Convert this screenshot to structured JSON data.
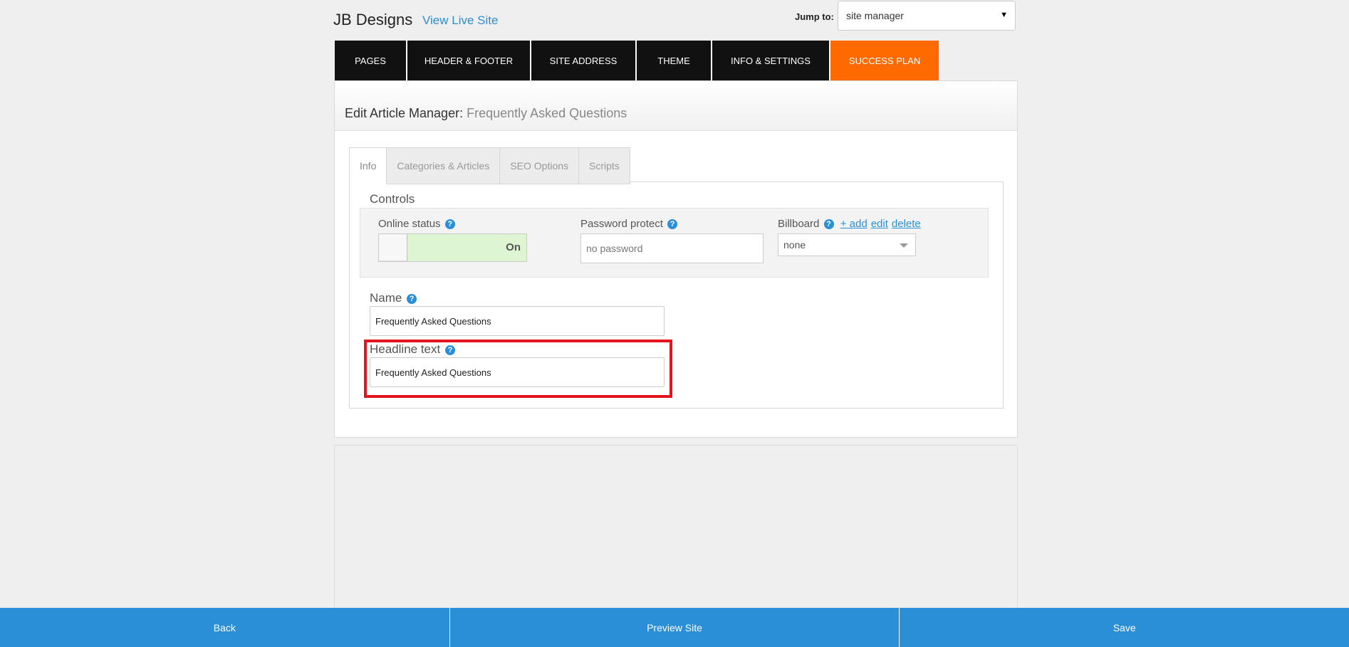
{
  "header": {
    "site_name": "JB Designs",
    "view_live_label": "View Live Site",
    "jump_label": "Jump to:",
    "jump_value": "site manager"
  },
  "nav": {
    "tabs": [
      {
        "label": "PAGES"
      },
      {
        "label": "HEADER & FOOTER"
      },
      {
        "label": "SITE ADDRESS"
      },
      {
        "label": "THEME"
      },
      {
        "label": "INFO & SETTINGS"
      },
      {
        "label": "SUCCESS PLAN"
      }
    ],
    "accent_color": "#ff6a00"
  },
  "editor": {
    "title_prefix": "Edit Article Manager:",
    "title_name": "Frequently Asked Questions",
    "tabs": [
      {
        "label": "Info",
        "active": true
      },
      {
        "label": "Categories & Articles",
        "active": false
      },
      {
        "label": "SEO Options",
        "active": false
      },
      {
        "label": "Scripts",
        "active": false
      }
    ],
    "controls": {
      "title": "Controls",
      "online_status_label": "Online status",
      "online_status_value": "On",
      "password_label": "Password protect",
      "password_placeholder": "no password",
      "billboard_label": "Billboard",
      "billboard_add": "+ add",
      "billboard_edit": "edit",
      "billboard_delete": "delete",
      "billboard_value": "none"
    },
    "name_label": "Name",
    "name_value": "Frequently Asked Questions",
    "headline_label": "Headline text",
    "headline_value": "Frequently Asked Questions",
    "help_glyph": "?"
  },
  "footer": {
    "back_label": "Back",
    "preview_label": "Preview Site",
    "save_label": "Save",
    "bar_color": "#2b8fd8"
  }
}
